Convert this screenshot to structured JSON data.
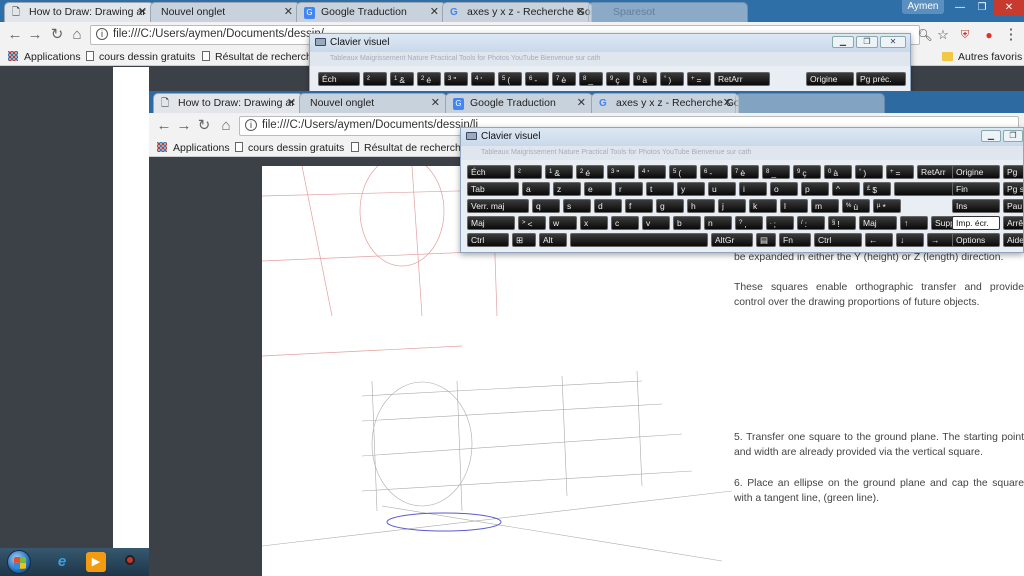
{
  "bg_browser": {
    "tabs": [
      {
        "label": "How to Draw: Drawing ar",
        "icon": "doc-icon"
      },
      {
        "label": "Nouvel onglet",
        "icon": ""
      },
      {
        "label": "Google Traduction",
        "icon": "translate-icon"
      },
      {
        "label": "axes y x z - Recherche Go",
        "icon": "google-icon"
      },
      {
        "label": "Sparesot",
        "icon": ""
      }
    ],
    "user": "Aymen",
    "url": "file:///C:/Users/aymen/Documents/dessin/",
    "bookmarks": [
      "Applications",
      "cours dessin gratuits",
      "Résultat de recherch"
    ],
    "other_bookmarks": "Autres favoris"
  },
  "fg_browser": {
    "tabs": [
      {
        "label": "How to Draw: Drawing ar",
        "icon": "doc-icon"
      },
      {
        "label": "Nouvel onglet",
        "icon": ""
      },
      {
        "label": "Google Traduction",
        "icon": "translate-icon"
      },
      {
        "label": "axes y x z - Recherche Go",
        "icon": "google-icon"
      },
      {
        "label": "",
        "icon": ""
      }
    ],
    "url": "file:///C:/Users/aymen/Documents/dessin/li",
    "bookmarks": [
      "Applications",
      "cours dessin gratuits",
      "Résultat de recherch"
    ]
  },
  "document": {
    "para_partial": "be expanded in either the Y (height) or Z (length) direction.",
    "para_2": "These squares enable orthographic transfer and provide control over the drawing proportions of future objects.",
    "step_5": "5. Transfer one square to the ground plane. The starting point and width are already provided via the vertical square.",
    "step_6": "6. Place an ellipse on the ground plane and cap the square with a tangent line, (green line)."
  },
  "osk": {
    "title": "Clavier visuel",
    "blurred_bookmarks": "Tableaux   Maigrissement  Nature   Practical Tools for   Photos  YouTube   Bienvenue sur cath"
  },
  "osk_fg_rows": [
    [
      {
        "t": "Éch",
        "w": 46
      },
      {
        "t": "²",
        "w": 30
      },
      {
        "s": "1",
        "t": "&",
        "w": 30
      },
      {
        "s": "2",
        "t": "é",
        "w": 30
      },
      {
        "s": "3",
        "t": "\"",
        "w": 30
      },
      {
        "s": "4",
        "t": "'",
        "w": 30
      },
      {
        "s": "5",
        "t": "(",
        "w": 30
      },
      {
        "s": "6",
        "t": "-",
        "w": 30
      },
      {
        "s": "7",
        "t": "è",
        "w": 30
      },
      {
        "s": "8",
        "t": "_",
        "w": 30
      },
      {
        "s": "9",
        "t": "ç",
        "w": 30
      },
      {
        "s": "0",
        "t": "à",
        "w": 30
      },
      {
        "s": "°",
        "t": ")",
        "w": 30
      },
      {
        "s": "+",
        "t": "=",
        "w": 30
      },
      {
        "t": "RetArr",
        "w": 58
      }
    ],
    [
      {
        "t": "Tab",
        "w": 54
      },
      {
        "t": "a",
        "w": 30
      },
      {
        "t": "z",
        "w": 30
      },
      {
        "t": "e",
        "w": 30
      },
      {
        "t": "r",
        "w": 30
      },
      {
        "t": "t",
        "w": 30
      },
      {
        "t": "y",
        "w": 30
      },
      {
        "t": "u",
        "w": 30
      },
      {
        "t": "i",
        "w": 30
      },
      {
        "t": "o",
        "w": 30
      },
      {
        "t": "p",
        "w": 30
      },
      {
        "t": "^",
        "w": 30
      },
      {
        "s": "£",
        "t": "$",
        "w": 30
      },
      {
        "t": "",
        "w": 62
      }
    ],
    [
      {
        "t": "Verr. maj",
        "w": 64
      },
      {
        "t": "q",
        "w": 30
      },
      {
        "t": "s",
        "w": 30
      },
      {
        "t": "d",
        "w": 30
      },
      {
        "t": "f",
        "w": 30
      },
      {
        "t": "g",
        "w": 30
      },
      {
        "t": "h",
        "w": 30
      },
      {
        "t": "j",
        "w": 30
      },
      {
        "t": "k",
        "w": 30
      },
      {
        "t": "l",
        "w": 30
      },
      {
        "t": "m",
        "w": 30
      },
      {
        "s": "%",
        "t": "ù",
        "w": 30
      },
      {
        "s": "µ",
        "t": "*",
        "w": 30
      }
    ],
    [
      {
        "t": "Maj",
        "w": 50
      },
      {
        "s": ">",
        "t": "<",
        "w": 30
      },
      {
        "t": "w",
        "w": 30
      },
      {
        "t": "x",
        "w": 30
      },
      {
        "t": "c",
        "w": 30
      },
      {
        "t": "v",
        "w": 30
      },
      {
        "t": "b",
        "w": 30
      },
      {
        "t": "n",
        "w": 30
      },
      {
        "s": "?",
        "t": ",",
        "w": 30
      },
      {
        "s": ".",
        "t": ";",
        "w": 30
      },
      {
        "s": "/",
        "t": ":",
        "w": 30
      },
      {
        "s": "§",
        "t": "!",
        "w": 30
      },
      {
        "t": "Maj",
        "w": 40
      },
      {
        "t": "↑",
        "w": 30
      },
      {
        "t": "Suppr",
        "w": 30
      }
    ],
    [
      {
        "t": "Ctrl",
        "w": 44
      },
      {
        "t": "⊞",
        "w": 26
      },
      {
        "t": "Alt",
        "w": 30
      },
      {
        "t": "",
        "w": 140
      },
      {
        "t": "AltGr",
        "w": 44
      },
      {
        "t": "▤",
        "w": 22
      },
      {
        "t": "Fn",
        "w": 34
      },
      {
        "t": "Ctrl",
        "w": 50
      },
      {
        "t": "←",
        "w": 30
      },
      {
        "t": "↓",
        "w": 30
      },
      {
        "t": "→",
        "w": 30
      }
    ]
  ],
  "osk_fg_side": [
    [
      "Origine",
      "Pg"
    ],
    [
      "Fin",
      "Pg s"
    ],
    [
      "Ins",
      "Pau"
    ],
    [
      "Imp. écr.",
      "Arrê"
    ],
    [
      "Options",
      "Aide"
    ]
  ],
  "osk_bg_row": [
    {
      "t": "Éch",
      "w": 44
    },
    {
      "t": "²",
      "w": 26
    },
    {
      "s": "1",
      "t": "&",
      "w": 26
    },
    {
      "s": "2",
      "t": "é",
      "w": 26
    },
    {
      "s": "3",
      "t": "\"",
      "w": 26
    },
    {
      "s": "4",
      "t": "'",
      "w": 26
    },
    {
      "s": "5",
      "t": "(",
      "w": 26
    },
    {
      "s": "6",
      "t": "-",
      "w": 26
    },
    {
      "s": "7",
      "t": "è",
      "w": 26
    },
    {
      "s": "8",
      "t": "_",
      "w": 26
    },
    {
      "s": "9",
      "t": "ç",
      "w": 26
    },
    {
      "s": "0",
      "t": "à",
      "w": 26
    },
    {
      "s": "°",
      "t": ")",
      "w": 26
    },
    {
      "s": "+",
      "t": "=",
      "w": 26
    },
    {
      "t": "RetArr",
      "w": 58
    }
  ],
  "osk_bg_side": [
    "Origine",
    "Pg préc."
  ],
  "taskbar": {
    "icons": [
      "ie-icon",
      "media-player-icon",
      "record-icon"
    ]
  }
}
